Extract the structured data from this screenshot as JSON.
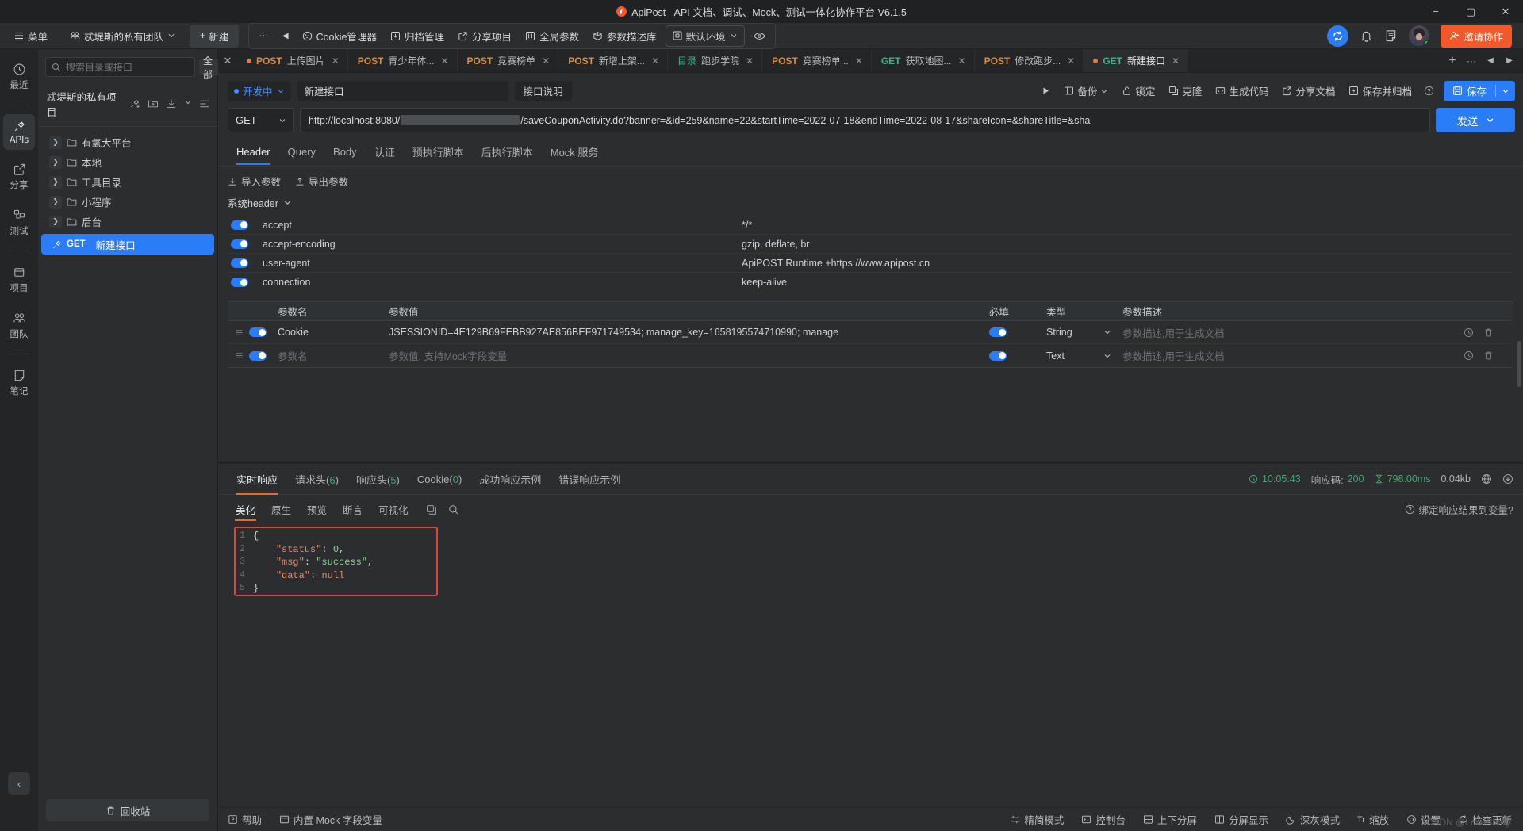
{
  "window": {
    "title": "ApiPost - API 文档、调试、Mock、测试一体化协作平台 V6.1.5",
    "minimize": "−",
    "maximize": "▢",
    "close": "✕"
  },
  "toolbar": {
    "menu": "菜单",
    "team": "忒堤斯的私有团队",
    "new": "新建",
    "more": "···",
    "back": "◀",
    "items": [
      {
        "label": "Cookie管理器",
        "icon": "cookie-icon"
      },
      {
        "label": "归档管理",
        "icon": "archive-icon"
      },
      {
        "label": "分享项目",
        "icon": "share-icon"
      },
      {
        "label": "全局参数",
        "icon": "global-param-icon"
      },
      {
        "label": "参数描述库",
        "icon": "param-lib-icon"
      }
    ],
    "env": "默认环境",
    "eye": "eye-icon",
    "invite": "邀请协作"
  },
  "rail": {
    "items": [
      {
        "label": "最近",
        "icon": "clock-icon",
        "active": false
      },
      {
        "label": "APIs",
        "icon": "api-icon",
        "active": true
      },
      {
        "label": "分享",
        "icon": "share-icon",
        "active": false
      },
      {
        "label": "测试",
        "icon": "test-icon",
        "active": false
      },
      {
        "label": "项目",
        "icon": "project-icon",
        "active": false
      },
      {
        "label": "团队",
        "icon": "team-icon",
        "active": false
      },
      {
        "label": "笔记",
        "icon": "note-icon",
        "active": false
      }
    ],
    "collapse": "‹"
  },
  "tree": {
    "search_placeholder": "搜索目录或接口",
    "filter": "全部",
    "project": "忒堤斯的私有项目",
    "items": [
      {
        "label": "有氧大平台",
        "type": "folder"
      },
      {
        "label": "本地",
        "type": "folder"
      },
      {
        "label": "工具目录",
        "type": "folder"
      },
      {
        "label": "小程序",
        "type": "folder"
      },
      {
        "label": "后台",
        "type": "folder"
      },
      {
        "label": "新建接口",
        "type": "api",
        "method": "GET",
        "selected": true
      }
    ],
    "recycle": "回收站"
  },
  "tabs": [
    {
      "method": "POST",
      "label": "上传图片",
      "dirty": true,
      "active": false
    },
    {
      "method": "POST",
      "label": "青少年体...",
      "dirty": false,
      "active": false
    },
    {
      "method": "POST",
      "label": "竞赛榜单",
      "dirty": false,
      "active": false
    },
    {
      "method": "POST",
      "label": "新增上架...",
      "dirty": false,
      "active": false
    },
    {
      "method": "目录",
      "label": "跑步学院",
      "dirty": false,
      "active": false
    },
    {
      "method": "POST",
      "label": "竞赛榜单...",
      "dirty": false,
      "active": false
    },
    {
      "method": "GET",
      "label": "获取地图...",
      "dirty": false,
      "active": false
    },
    {
      "method": "POST",
      "label": "修改跑步...",
      "dirty": false,
      "active": false
    },
    {
      "method": "GET",
      "label": "新建接口",
      "dirty": true,
      "active": true
    }
  ],
  "tabstrip": {
    "add": "+",
    "more": "···",
    "prev": "◀",
    "next": "▶"
  },
  "request": {
    "status": "开发中",
    "name": "新建接口",
    "desc_button": "接口说明",
    "actions": [
      {
        "label": "备份",
        "icon": "backup-icon"
      },
      {
        "label": "锁定",
        "icon": "lock-icon"
      },
      {
        "label": "克隆",
        "icon": "clone-icon"
      },
      {
        "label": "生成代码",
        "icon": "code-icon"
      },
      {
        "label": "分享文档",
        "icon": "share-icon"
      },
      {
        "label": "保存并归档",
        "icon": "save-archive-icon"
      }
    ],
    "save": "保存",
    "method": "GET",
    "url_prefix": "http://localhost:8080/",
    "url_suffix": "/saveCouponActivity.do?banner=&id=259&name=22&startTime=2022-07-18&endTime=2022-08-17&shareIcon=&shareTitle=&sha",
    "send": "发送",
    "tabs": [
      "Header",
      "Query",
      "Body",
      "认证",
      "预执行脚本",
      "后执行脚本",
      "Mock 服务"
    ],
    "active_tab": "Header",
    "import_params": "导入参数",
    "export_params": "导出参数",
    "system_header": "系统header",
    "system_headers": [
      {
        "name": "accept",
        "value": "*/*",
        "on": true
      },
      {
        "name": "accept-encoding",
        "value": "gzip, deflate, br",
        "on": true
      },
      {
        "name": "user-agent",
        "value": "ApiPOST Runtime +https://www.apipost.cn",
        "on": true
      },
      {
        "name": "connection",
        "value": "keep-alive",
        "on": true
      }
    ],
    "param_columns": [
      "参数名",
      "参数值",
      "必填",
      "类型",
      "参数描述"
    ],
    "params": [
      {
        "name": "Cookie",
        "value": "JSESSIONID=4E129B69FEBB927AE856BEF971749534; manage_key=1658195574710990; manage",
        "required": true,
        "type": "String",
        "desc": "参数描述,用于生成文档",
        "on": true,
        "placeholder": false
      },
      {
        "name": "参数名",
        "value": "参数值, 支持Mock字段变量",
        "required": true,
        "type": "Text",
        "desc": "参数描述,用于生成文档",
        "on": true,
        "placeholder": true
      }
    ]
  },
  "response": {
    "tabs": [
      {
        "label": "实时响应",
        "count": "",
        "active": true
      },
      {
        "label": "请求头",
        "count": "6",
        "active": false
      },
      {
        "label": "响应头",
        "count": "5",
        "active": false
      },
      {
        "label": "Cookie",
        "count": "0",
        "active": false
      },
      {
        "label": "成功响应示例",
        "count": "",
        "active": false
      },
      {
        "label": "错误响应示例",
        "count": "",
        "active": false
      }
    ],
    "time": "10:05:43",
    "code_label": "响应码:",
    "code_value": "200",
    "duration": "798.00ms",
    "size": "0.04kb",
    "sub_tabs": [
      "美化",
      "原生",
      "预览",
      "断言",
      "可视化"
    ],
    "active_sub": "美化",
    "copy_icon": "copy-icon",
    "search_icon": "search-icon",
    "bind_var": "绑定响应结果到变量?",
    "body_lines": [
      "1",
      "2",
      "3",
      "4",
      "5"
    ],
    "body": {
      "status_key": "\"status\"",
      "status_val": "0",
      "msg_key": "\"msg\"",
      "msg_val": "\"success\"",
      "data_key": "\"data\"",
      "data_val": "null"
    }
  },
  "statusbar": {
    "help": "帮助",
    "mock": "内置 Mock 字段变量",
    "right": [
      {
        "label": "精简模式",
        "icon": "compact-icon"
      },
      {
        "label": "控制台",
        "icon": "console-icon"
      },
      {
        "label": "上下分屏",
        "icon": "split-v-icon"
      },
      {
        "label": "分屏显示",
        "icon": "split-h-icon"
      },
      {
        "label": "深灰模式",
        "icon": "moon-icon"
      },
      {
        "label": "缩放",
        "icon": "zoom-icon"
      },
      {
        "label": "设置",
        "icon": "gear-icon"
      },
      {
        "label": "检查更新",
        "icon": "refresh-icon"
      }
    ]
  },
  "watermark": "CSDN @LoveStady",
  "colors": {
    "accent": "#2a7cf7",
    "orange": "#f1592a",
    "green": "#3fa86f",
    "post": "#d98c3f",
    "get": "#3eb489",
    "highlight": "#e8403a"
  }
}
